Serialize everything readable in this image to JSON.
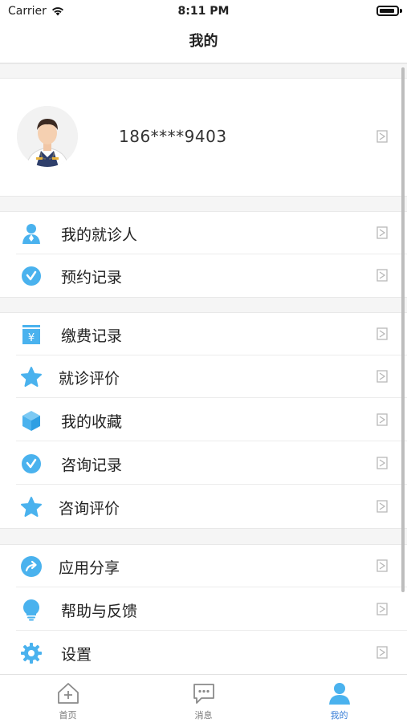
{
  "status_bar": {
    "carrier": "Carrier",
    "time": "8:11 PM"
  },
  "nav": {
    "title": "我的"
  },
  "profile": {
    "phone": "186****9403"
  },
  "menu_groups": [
    [
      {
        "label": "我的就诊人",
        "icon": "user-icon"
      },
      {
        "label": "预约记录",
        "icon": "clock-icon"
      }
    ],
    [
      {
        "label": "缴费记录",
        "icon": "yen-receipt-icon"
      },
      {
        "label": "就诊评价",
        "icon": "star-icon"
      },
      {
        "label": "我的收藏",
        "icon": "box-icon"
      },
      {
        "label": "咨询记录",
        "icon": "clock-icon"
      },
      {
        "label": "咨询评价",
        "icon": "star-icon"
      }
    ],
    [
      {
        "label": "应用分享",
        "icon": "share-icon"
      },
      {
        "label": "帮助与反馈",
        "icon": "lightbulb-icon"
      },
      {
        "label": "设置",
        "icon": "gear-icon"
      }
    ]
  ],
  "tabs": [
    {
      "label": "首页",
      "icon": "home-icon"
    },
    {
      "label": "消息",
      "icon": "message-icon"
    },
    {
      "label": "我的",
      "icon": "profile-icon"
    }
  ],
  "colors": {
    "accent": "#4ab2ee",
    "active_tab": "#3a7fd8"
  }
}
